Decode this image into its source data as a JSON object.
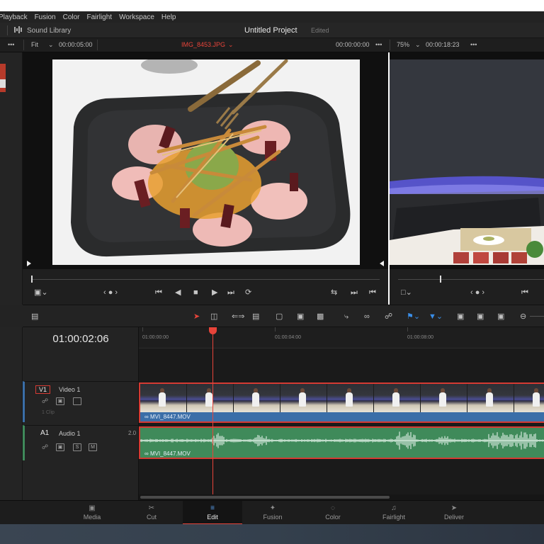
{
  "menu": {
    "items": [
      "Playback",
      "Fusion",
      "Color",
      "Fairlight",
      "Workspace",
      "Help"
    ]
  },
  "titlebar": {
    "sound_library": "Sound Library",
    "project_title": "Untitled Project",
    "status": "Edited"
  },
  "viewer_header": {
    "more_left": "•••",
    "fit": "Fit",
    "source_duration": "00:00:05:00",
    "clip_name": "IMG_8453.JPG",
    "source_timecode": "00:00:00:00",
    "more_mid": "•••",
    "zoom": "75%",
    "program_duration": "00:00:18:23",
    "more_right": "•••"
  },
  "timeline": {
    "timecode": "01:00:02:06",
    "ruler_labels": [
      "01:00:00:00",
      "01:00:04:00",
      "01:00:08:00"
    ],
    "video_track": {
      "id": "V1",
      "name": "Video 1",
      "clip_count": "1 Clip",
      "clip_name": "MVI_8447.MOV"
    },
    "audio_track": {
      "id": "A1",
      "name": "Audio 1",
      "channels": "2.0",
      "solo": "S",
      "mute": "M",
      "clip_name": "MVI_8447.MOV"
    }
  },
  "pages": [
    {
      "label": "Media",
      "icon": "media-icon",
      "glyph": "▣"
    },
    {
      "label": "Cut",
      "icon": "cut-icon",
      "glyph": "✂"
    },
    {
      "label": "Edit",
      "icon": "edit-icon",
      "glyph": "≡"
    },
    {
      "label": "Fusion",
      "icon": "fusion-icon",
      "glyph": "✦"
    },
    {
      "label": "Color",
      "icon": "color-icon",
      "glyph": "◌"
    },
    {
      "label": "Fairlight",
      "icon": "fairlight-icon",
      "glyph": "♫"
    },
    {
      "label": "Deliver",
      "icon": "deliver-icon",
      "glyph": "➤"
    }
  ],
  "active_page": "Edit",
  "colors": {
    "accent_red": "#e8443a",
    "video_clip": "#3b6ea8",
    "audio_clip": "#3f8a5a",
    "marker_blue": "#3a8ee8"
  }
}
